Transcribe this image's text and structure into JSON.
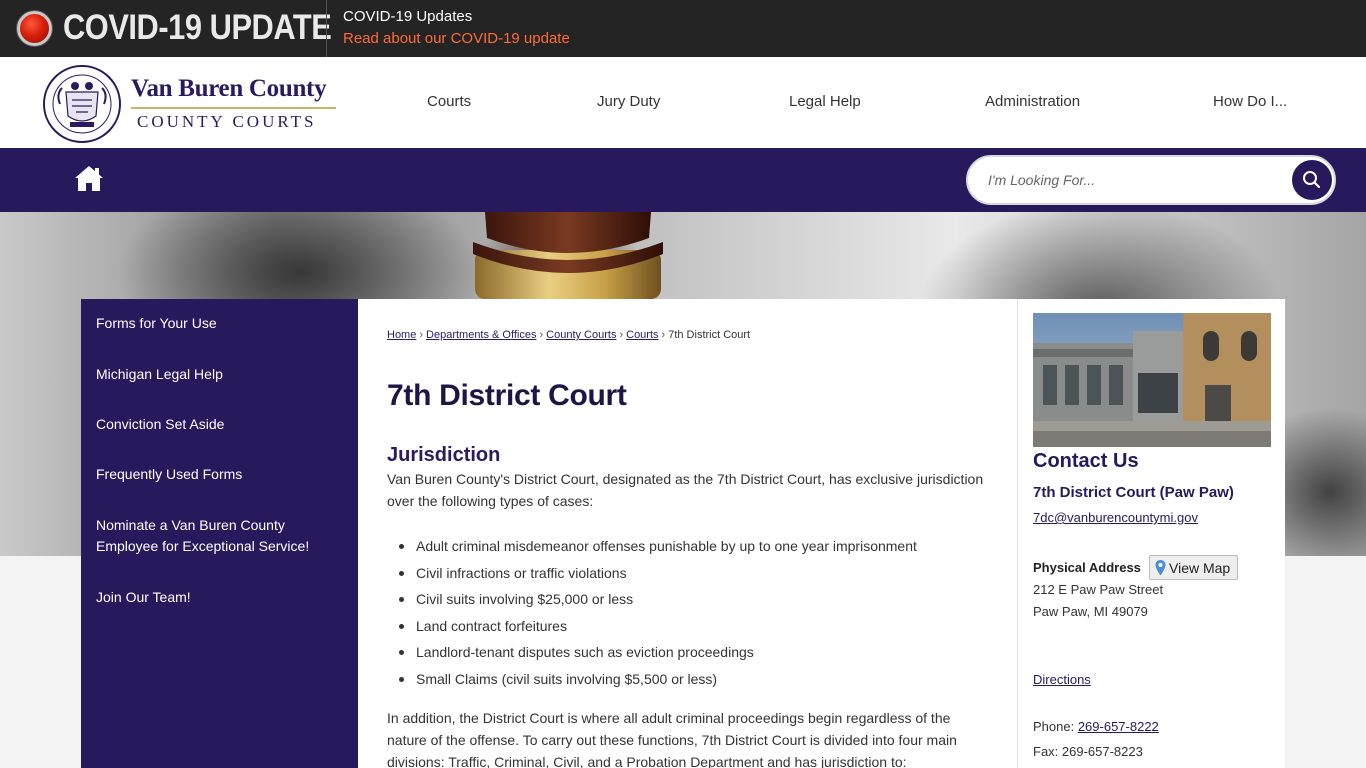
{
  "alert": {
    "title": "COVID-19 UPDATE",
    "heading": "COVID-19 Updates",
    "link": "Read about our COVID-19 update",
    "link_color": "#ff6a3a",
    "icon": "alert-dot-icon"
  },
  "brand": {
    "name": "Van Buren County",
    "subtitle": "COUNTY COURTS",
    "seal_text_top": "VAN BUREN COUNTY COURTS",
    "seal_text_bottom": "STATE OF MICHIGAN",
    "primary_color": "#27195b"
  },
  "main_nav": [
    "Courts",
    "Jury Duty",
    "Legal Help",
    "Administration",
    "How Do I..."
  ],
  "search": {
    "placeholder": "I'm Looking For...",
    "icon": "search-icon"
  },
  "home": {
    "icon": "home-icon"
  },
  "side_nav": [
    "Forms for Your Use",
    "Michigan Legal Help",
    "Conviction Set Aside",
    "Frequently Used Forms",
    "Nominate a Van Buren County Employee for Exceptional Service!",
    "Join Our Team!"
  ],
  "breadcrumb": [
    "Home",
    "Departments & Offices",
    "County Courts",
    "Courts",
    "7th District Court"
  ],
  "page": {
    "title": "7th District Court",
    "section_heading": "Jurisdiction",
    "intro": "Van Buren County's District Court, designated as the 7th District Court, has exclusive jurisdiction over the following types of cases:",
    "cases": [
      "Adult criminal misdemeanor offenses punishable by up to one year imprisonment",
      "Civil infractions or traffic violations",
      "Civil suits involving $25,000 or less",
      "Land contract forfeitures",
      "Landlord-tenant disputes such as eviction proceedings",
      "Small Claims (civil suits involving $5,500 or less)"
    ],
    "closing": "In addition, the District Court is where all adult criminal proceedings begin regardless of the nature of the offense. To carry out these functions, 7th District Court is divided into four main divisions: Traffic, Criminal, Civil, and a Probation Department and has jurisdiction to:"
  },
  "contact": {
    "title": "Contact Us",
    "court_name": "7th District Court (Paw Paw)",
    "email": "7dc@vanburencountymi.gov",
    "address_label": "Physical Address",
    "view_map": "View Map",
    "street": "212 E Paw Paw Street",
    "city": "Paw Paw, MI 49079",
    "directions": "Directions",
    "phone_label": "Phone: ",
    "phone": "269-657-8222",
    "fax": "Fax: 269-657-8223"
  }
}
